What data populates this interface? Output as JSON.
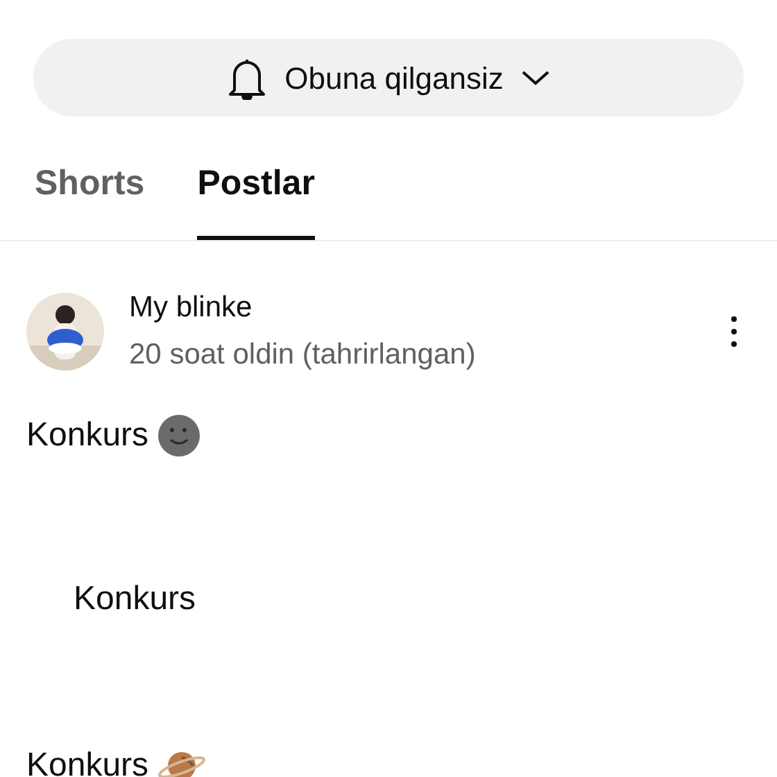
{
  "subscribe_button": {
    "label": "Obuna qilgansiz"
  },
  "tabs": [
    {
      "label": "Shorts",
      "selected": false
    },
    {
      "label": "Postlar",
      "selected": true
    }
  ],
  "post": {
    "author": "My blinke",
    "time": "20 soat oldin (tahrirlangan)",
    "lines": [
      {
        "text": "Konkurs",
        "kind": "moon"
      },
      {
        "text": "Konkurs",
        "kind": "indented"
      },
      {
        "text": "Konkurs",
        "kind": "planet"
      }
    ]
  }
}
